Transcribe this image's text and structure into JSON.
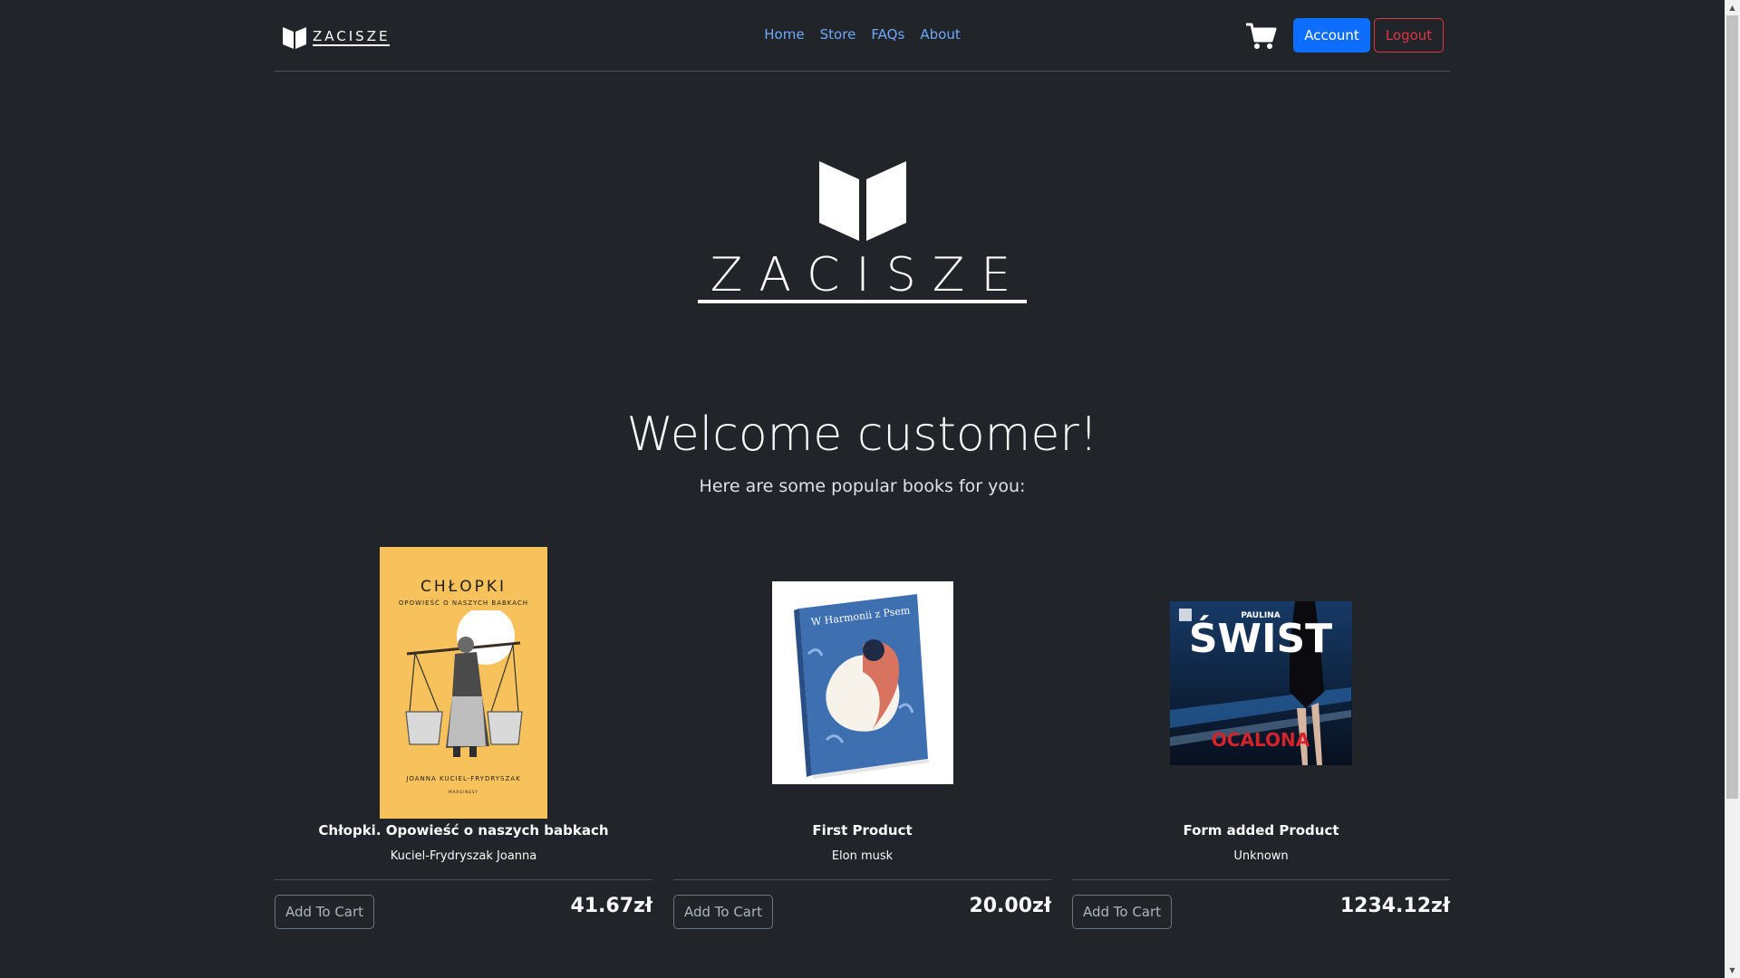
{
  "brand": {
    "name": "ZACISZE"
  },
  "nav": {
    "items": [
      "Home",
      "Store",
      "FAQs",
      "About"
    ]
  },
  "header": {
    "account_label": "Account",
    "logout_label": "Logout"
  },
  "hero": {
    "logo_text": "ZACISZE",
    "welcome": "Welcome customer!",
    "subtitle": "Here are some popular books for you:"
  },
  "products": [
    {
      "title": "Chłopki. Opowieść o naszych babkach",
      "author": "Kuciel-Frydryszak Joanna",
      "price": "41.67zł",
      "button": "Add To Cart",
      "cover": {
        "title": "CHŁOPKI",
        "subtitle": "OPOWIEŚĆ O NASZYCH BABKACH",
        "author": "JOANNA KUCIEL-FRYDRYSZAK",
        "publisher": "MARGINESY",
        "color": "#f7c25b"
      }
    },
    {
      "title": "First Product",
      "author": "Elon musk",
      "price": "20.00zł",
      "button": "Add To Cart",
      "cover": {
        "title": "W Harmonii z Psem",
        "color": "#3e6fb0"
      }
    },
    {
      "title": "Form added Product",
      "author": "Unknown",
      "price": "1234.12zł",
      "button": "Add To Cart",
      "cover": {
        "author": "PAULINA",
        "title": "ŚWIST",
        "subtitle": "OCALONA",
        "color": "#0b1a33"
      }
    }
  ],
  "colors": {
    "background": "#212529",
    "primary": "#0d6efd",
    "danger": "#dc3545",
    "link": "#6ea8fe"
  }
}
